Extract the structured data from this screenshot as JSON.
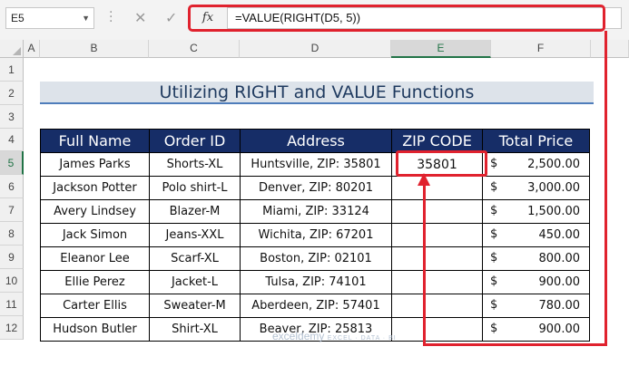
{
  "formula_bar": {
    "name_box": "E5",
    "cancel_icon": "✕",
    "enter_icon": "✓",
    "fx_label": "fx",
    "formula": "=VALUE(RIGHT(D5, 5))"
  },
  "columns": [
    "A",
    "B",
    "C",
    "D",
    "E",
    "F"
  ],
  "rows": [
    "1",
    "2",
    "3",
    "4",
    "5",
    "6",
    "7",
    "8",
    "9",
    "10",
    "11",
    "12"
  ],
  "title": "Utilizing RIGHT and VALUE Functions",
  "table": {
    "headers": [
      "Full Name",
      "Order ID",
      "Address",
      "ZIP CODE",
      "Total Price"
    ],
    "rows": [
      {
        "name": "James Parks",
        "order": "Shorts-XL",
        "address": "Huntsville, ZIP: 35801",
        "zip": "35801",
        "currency": "$",
        "price": "2,500.00"
      },
      {
        "name": "Jackson Potter",
        "order": "Polo shirt-L",
        "address": "Denver, ZIP: 80201",
        "zip": "",
        "currency": "$",
        "price": "3,000.00"
      },
      {
        "name": "Avery Lindsey",
        "order": "Blazer-M",
        "address": "Miami, ZIP: 33124",
        "zip": "",
        "currency": "$",
        "price": "1,500.00"
      },
      {
        "name": "Jack Simon",
        "order": "Jeans-XXL",
        "address": "Wichita, ZIP: 67201",
        "zip": "",
        "currency": "$",
        "price": "450.00"
      },
      {
        "name": "Eleanor Lee",
        "order": "Scarf-XL",
        "address": "Boston, ZIP: 02101",
        "zip": "",
        "currency": "$",
        "price": "800.00"
      },
      {
        "name": "Ellie Perez",
        "order": "Jacket-L",
        "address": "Tulsa, ZIP: 74101",
        "zip": "",
        "currency": "$",
        "price": "900.00"
      },
      {
        "name": "Carter Ellis",
        "order": "Sweater-M",
        "address": "Aberdeen, ZIP: 57401",
        "zip": "",
        "currency": "$",
        "price": "780.00"
      },
      {
        "name": "Hudson Butler",
        "order": "Shirt-XL",
        "address": "Beaver, ZIP: 25813",
        "zip": "",
        "currency": "$",
        "price": "900.00"
      }
    ]
  },
  "watermark": {
    "main": "exceldemy",
    "sub": "EXCEL · DATA · BI"
  },
  "colors": {
    "header_bg": "#162d67",
    "highlight": "#e0222e",
    "title_bg": "#dde3ea"
  }
}
